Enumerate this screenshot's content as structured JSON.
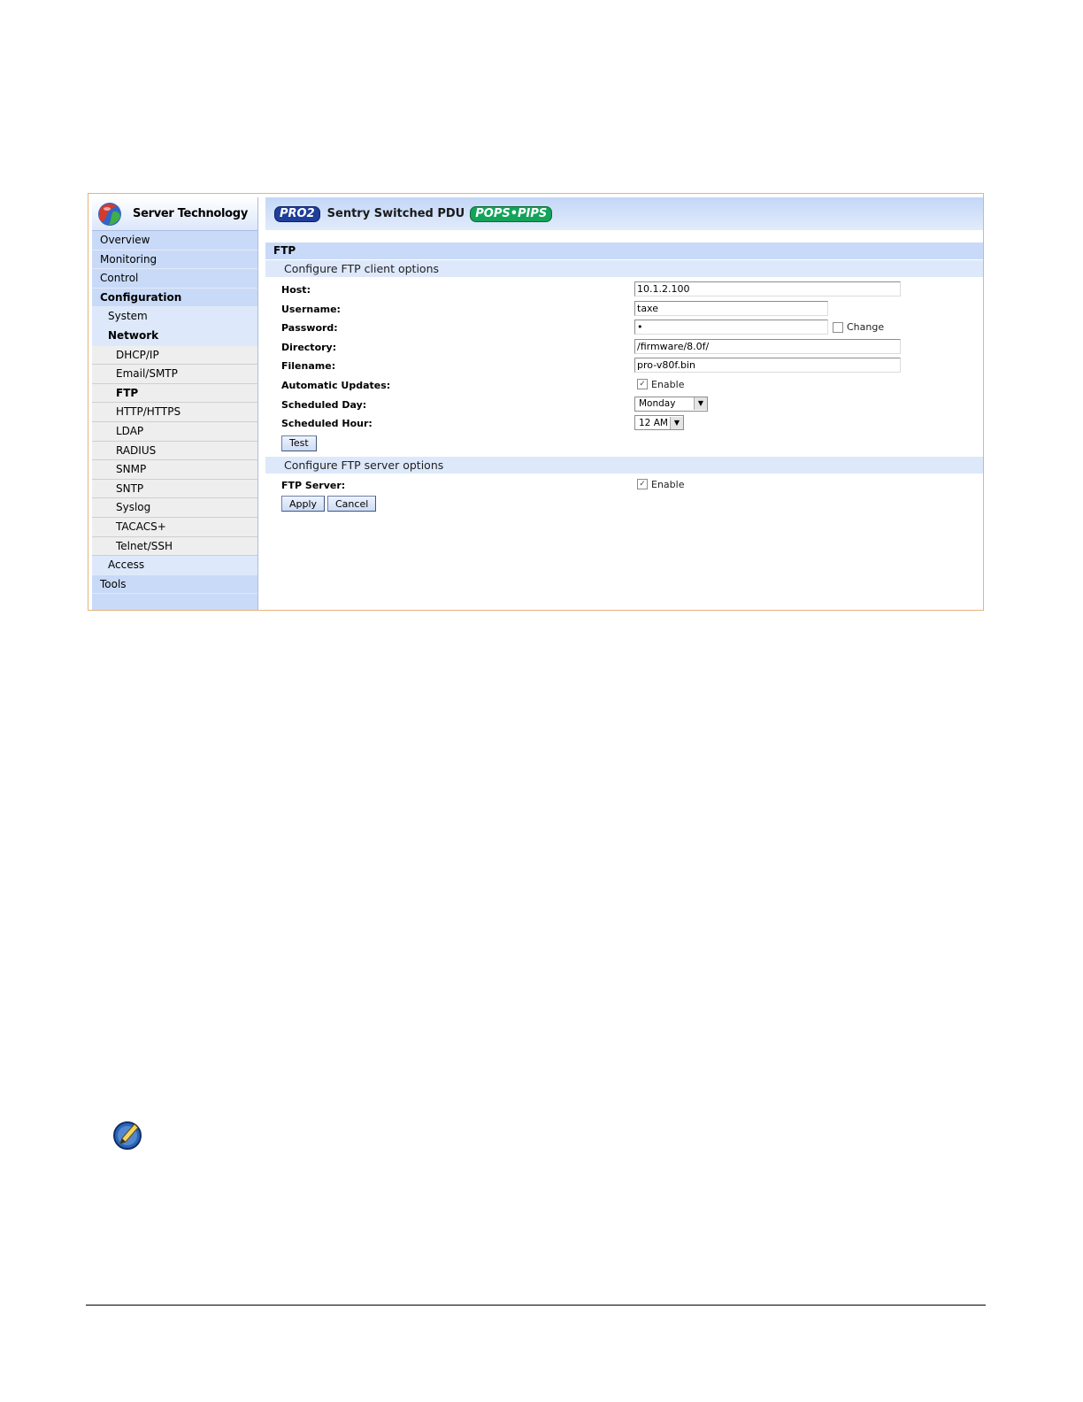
{
  "brand": {
    "name": "Server Technology"
  },
  "header": {
    "pro_badge": "PRO2",
    "title": "Sentry Switched PDU",
    "pops_badge": "POPS•PIPS"
  },
  "nav": [
    {
      "label": "Overview",
      "level": 0,
      "bold": false
    },
    {
      "label": "Monitoring",
      "level": 0,
      "bold": false
    },
    {
      "label": "Control",
      "level": 0,
      "bold": false
    },
    {
      "label": "Configuration",
      "level": 0,
      "bold": true
    },
    {
      "label": "System",
      "level": 1,
      "bold": false
    },
    {
      "label": "Network",
      "level": 1,
      "bold": true
    },
    {
      "label": "DHCP/IP",
      "level": 2,
      "bold": false
    },
    {
      "label": "Email/SMTP",
      "level": 2,
      "bold": false
    },
    {
      "label": "FTP",
      "level": 2,
      "bold": true
    },
    {
      "label": "HTTP/HTTPS",
      "level": 2,
      "bold": false
    },
    {
      "label": "LDAP",
      "level": 2,
      "bold": false
    },
    {
      "label": "RADIUS",
      "level": 2,
      "bold": false
    },
    {
      "label": "SNMP",
      "level": 2,
      "bold": false
    },
    {
      "label": "SNTP",
      "level": 2,
      "bold": false
    },
    {
      "label": "Syslog",
      "level": 2,
      "bold": false
    },
    {
      "label": "TACACS+",
      "level": 2,
      "bold": false
    },
    {
      "label": "Telnet/SSH",
      "level": 2,
      "bold": false
    },
    {
      "label": "Access",
      "level": 1,
      "bold": false
    },
    {
      "label": "Tools",
      "level": 0,
      "bold": false
    }
  ],
  "page": {
    "title": "FTP"
  },
  "client": {
    "heading": "Configure FTP client options",
    "host": {
      "label": "Host:",
      "value": "10.1.2.100"
    },
    "username": {
      "label": "Username:",
      "value": "taxe"
    },
    "password": {
      "label": "Password:",
      "value": "•",
      "change_label": "Change",
      "change_checked": false
    },
    "directory": {
      "label": "Directory:",
      "value": "/firmware/8.0f/"
    },
    "filename": {
      "label": "Filename:",
      "value": "pro-v80f.bin"
    },
    "auto_updates": {
      "label": "Automatic Updates:",
      "enable_label": "Enable",
      "checked": true
    },
    "scheduled_day": {
      "label": "Scheduled Day:",
      "value": "Monday"
    },
    "scheduled_hour": {
      "label": "Scheduled Hour:",
      "value": "12 AM"
    },
    "test_label": "Test"
  },
  "server": {
    "heading": "Configure FTP server options",
    "ftp_server": {
      "label": "FTP Server:",
      "enable_label": "Enable",
      "checked": true
    },
    "apply_label": "Apply",
    "cancel_label": "Cancel"
  },
  "colors": {
    "frame_border": "#e7b27e",
    "nav_bg": "#c9daf8",
    "pro_badge": "#1f3f9a",
    "pops_badge": "#13a35a"
  },
  "icons": {
    "logo": "globe-logo-icon",
    "note": "pencil-note-icon"
  }
}
